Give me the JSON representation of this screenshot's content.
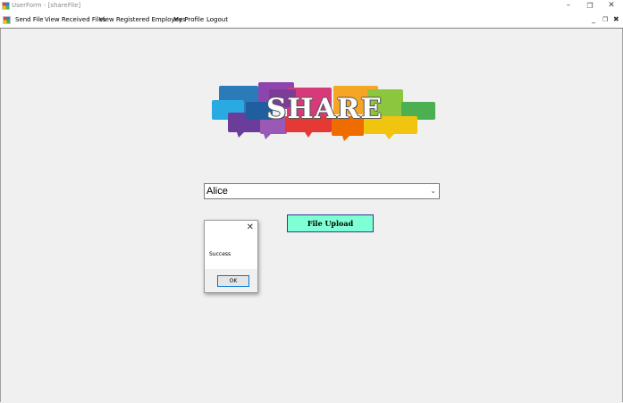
{
  "window": {
    "title": "UserForm - [shareFile]",
    "minimize": "–",
    "restore": "❐",
    "close": "✕"
  },
  "menu": {
    "items": [
      "Send File",
      "View Received Files",
      "View Registered Employees",
      "My Profile",
      "Logout"
    ],
    "mdi_minimize": "_",
    "mdi_restore": "❐",
    "mdi_close": "✖"
  },
  "logo": {
    "text": "SHARE"
  },
  "recipient_combo": {
    "selected": "Alice",
    "arrow": "⌄"
  },
  "upload_button": {
    "label": "File Upload"
  },
  "message_box": {
    "close": "✕",
    "message": "Success",
    "ok_label": "OK"
  },
  "colors": {
    "upload_button_bg": "#7fffd4",
    "ok_button_border": "#0078d7"
  }
}
